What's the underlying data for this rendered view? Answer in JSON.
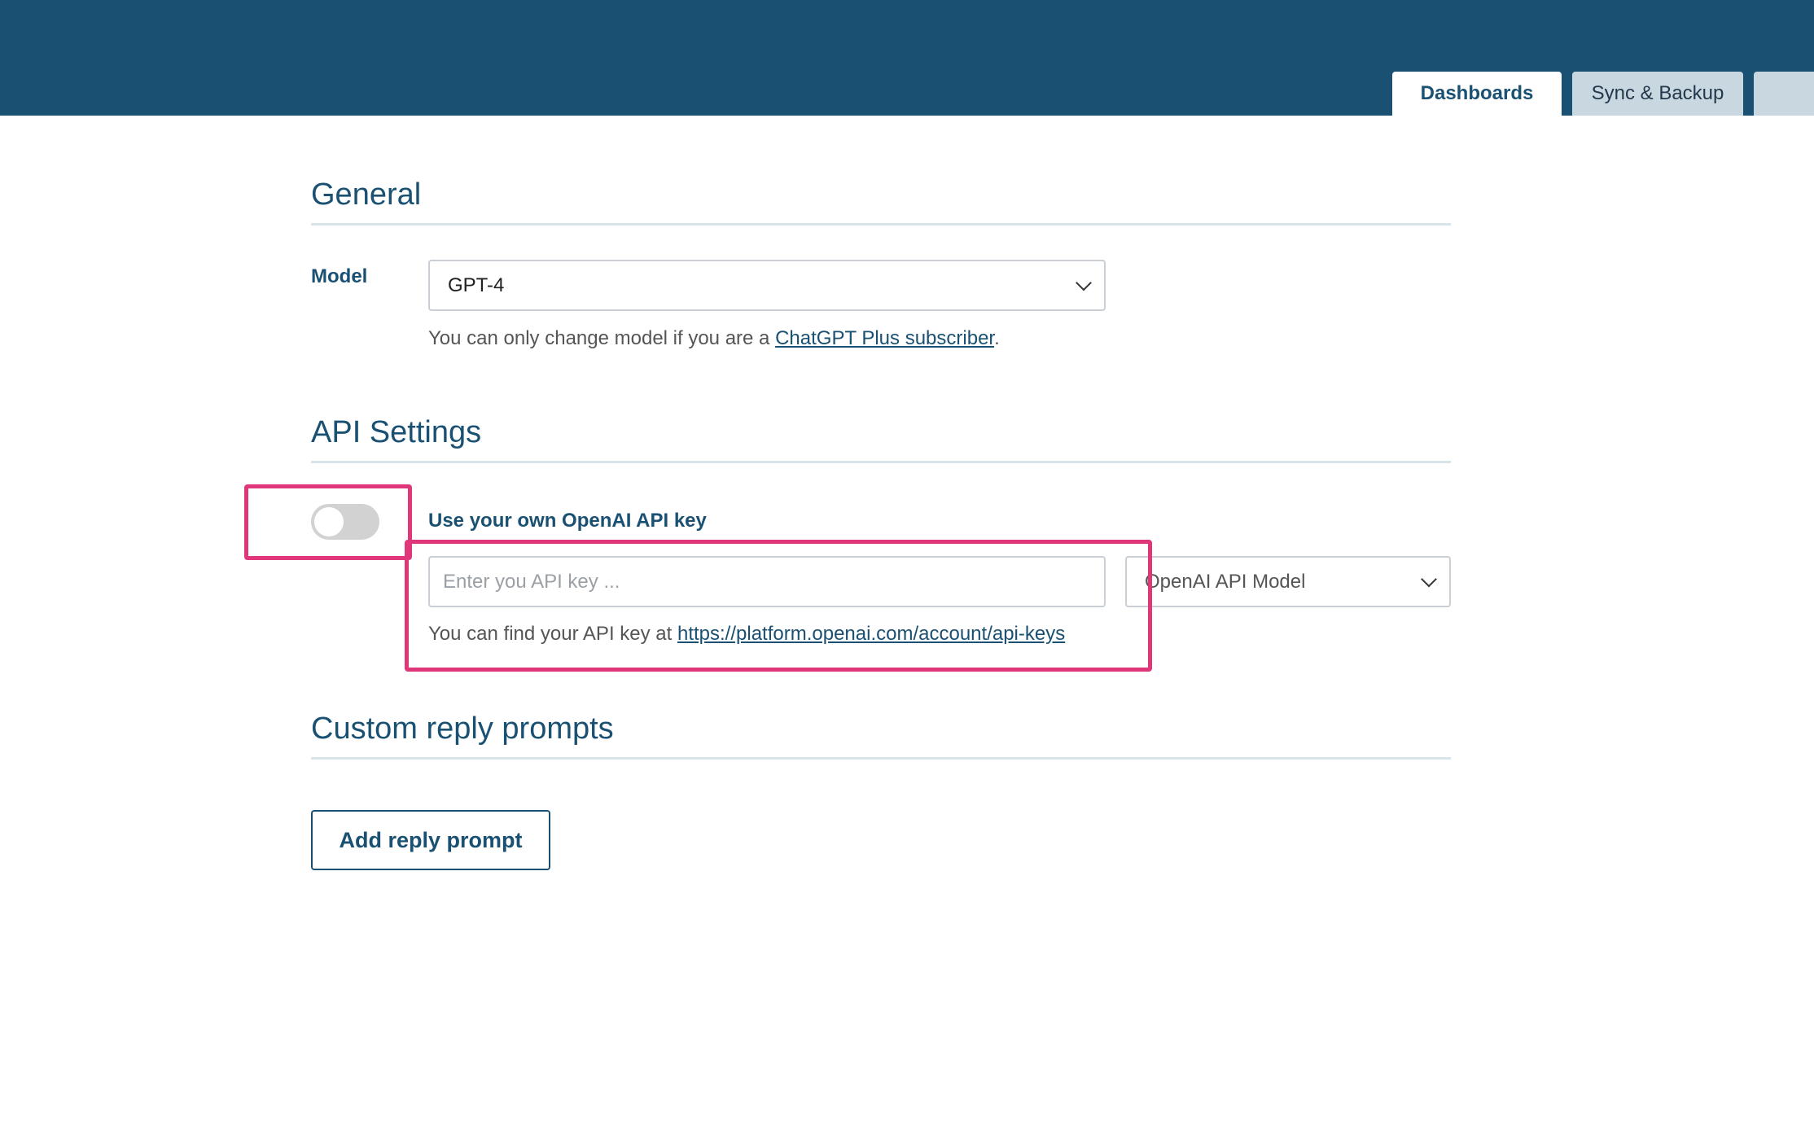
{
  "header": {
    "tabs": [
      {
        "label": "Dashboards",
        "active": true
      },
      {
        "label": "Sync & Backup",
        "active": false
      },
      {
        "label": "",
        "active": false
      }
    ]
  },
  "general": {
    "title": "General",
    "model_label": "Model",
    "model_value": "GPT-4",
    "helper_prefix": "You can only change model if you are a ",
    "helper_link": "ChatGPT Plus subscriber",
    "helper_suffix": "."
  },
  "api_settings": {
    "title": "API Settings",
    "toggle_on": false,
    "toggle_label": "Use your own OpenAI API key",
    "api_key_placeholder": "Enter you API key ...",
    "api_key_value": "",
    "api_model_value": "OpenAI API Model",
    "helper_prefix": "You can find your API key at ",
    "helper_link": "https://platform.openai.com/account/api-keys"
  },
  "custom_prompts": {
    "title": "Custom reply prompts",
    "add_button": "Add reply prompt"
  },
  "colors": {
    "header_bg": "#1a5172",
    "accent": "#1a5172",
    "highlight": "#e0367a"
  }
}
